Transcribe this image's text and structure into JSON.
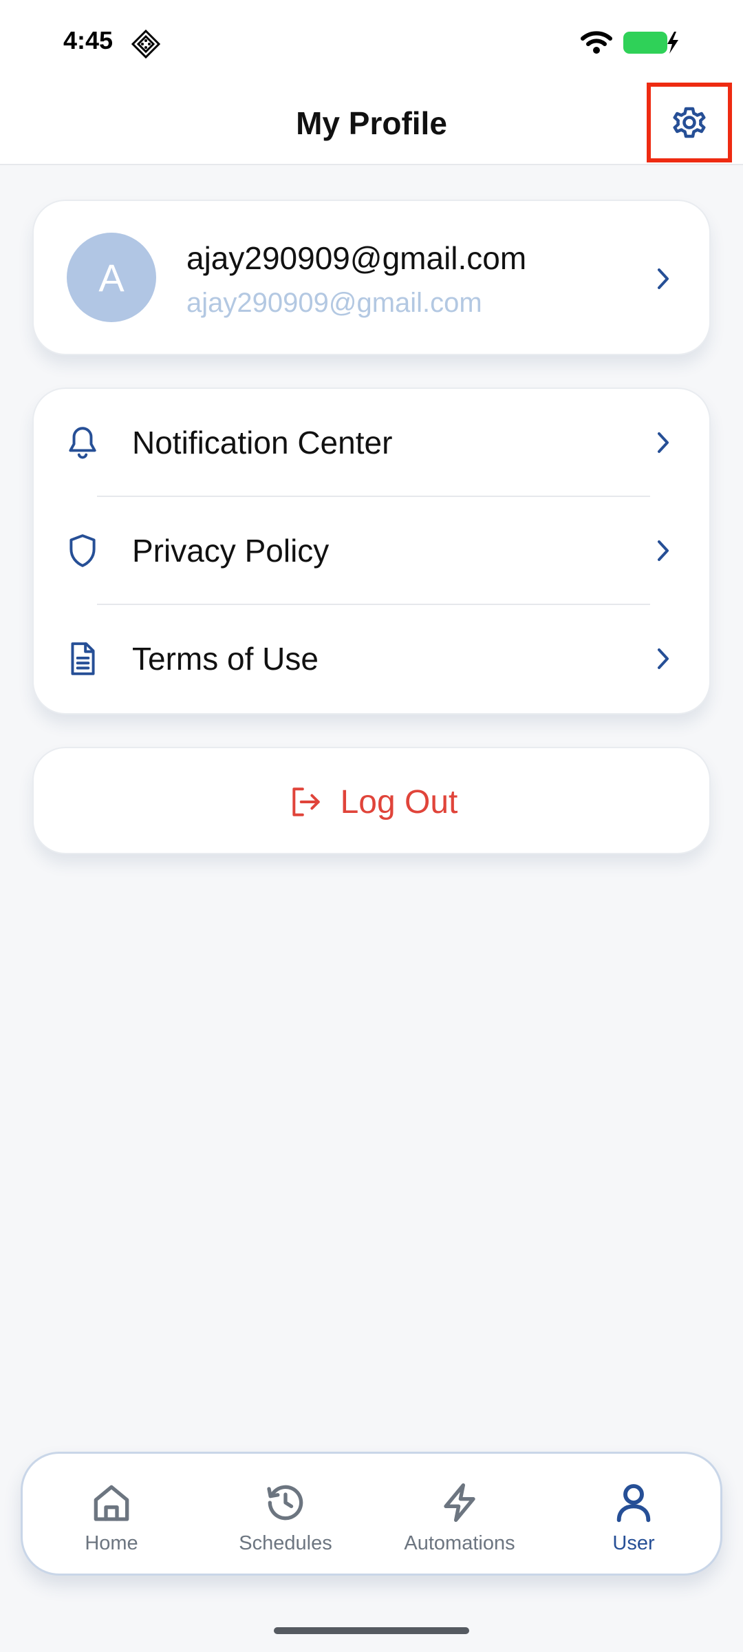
{
  "status_bar": {
    "time": "4:45"
  },
  "header": {
    "title": "My Profile",
    "settings_icon": "gear-icon"
  },
  "profile": {
    "avatar_initial": "A",
    "email": "ajay290909@gmail.com",
    "subtitle": "ajay290909@gmail.com"
  },
  "menu": {
    "items": [
      {
        "label": "Notification Center",
        "icon": "bell-icon"
      },
      {
        "label": "Privacy Policy",
        "icon": "shield-icon"
      },
      {
        "label": "Terms of Use",
        "icon": "document-icon"
      }
    ]
  },
  "logout": {
    "label": "Log Out",
    "icon": "logout-icon"
  },
  "tabs": {
    "items": [
      {
        "label": "Home",
        "icon": "home-icon"
      },
      {
        "label": "Schedules",
        "icon": "history-icon"
      },
      {
        "label": "Automations",
        "icon": "lightning-icon"
      },
      {
        "label": "User",
        "icon": "user-icon"
      }
    ],
    "active": "User"
  },
  "colors": {
    "accent": "#264f96",
    "danger": "#e0443a",
    "battery": "#2fd158",
    "highlight_box": "#ee2b12",
    "avatar_bg": "#b1c6e4"
  }
}
